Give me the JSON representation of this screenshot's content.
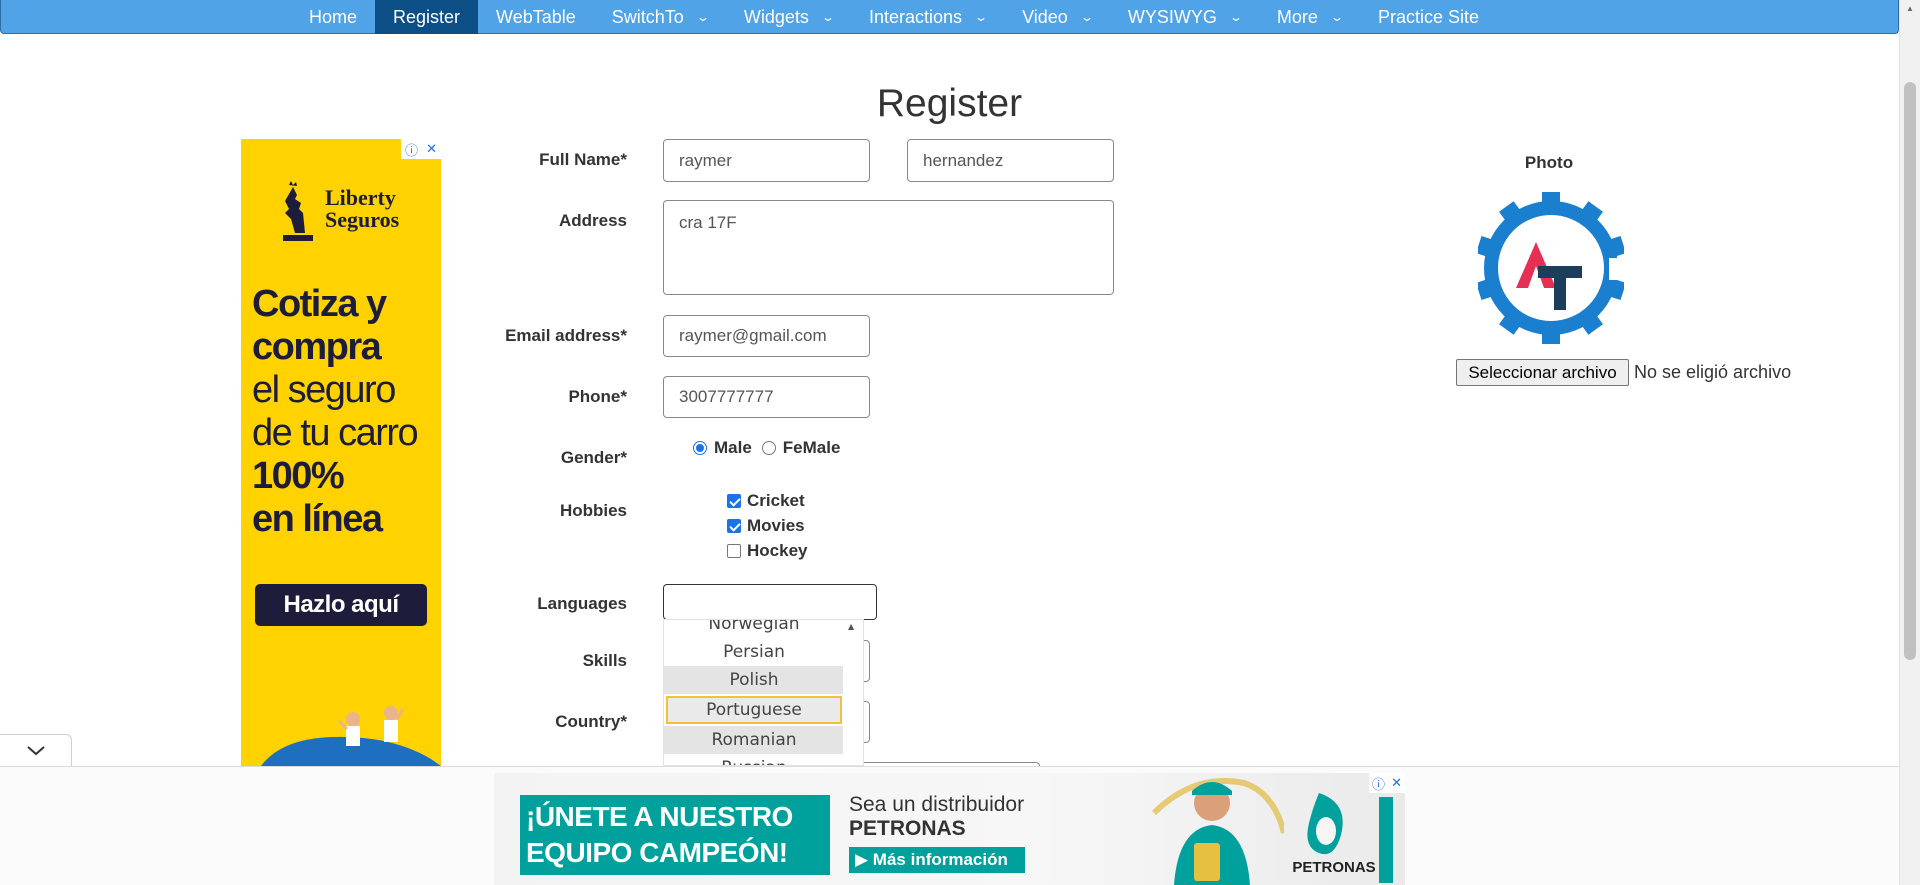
{
  "nav": {
    "items": [
      {
        "label": "Home",
        "dropdown": false,
        "active": false
      },
      {
        "label": "Register",
        "dropdown": false,
        "active": true
      },
      {
        "label": "WebTable",
        "dropdown": false,
        "active": false
      },
      {
        "label": "SwitchTo",
        "dropdown": true,
        "active": false
      },
      {
        "label": "Widgets",
        "dropdown": true,
        "active": false
      },
      {
        "label": "Interactions",
        "dropdown": true,
        "active": false
      },
      {
        "label": "Video",
        "dropdown": true,
        "active": false
      },
      {
        "label": "WYSIWYG",
        "dropdown": true,
        "active": false
      },
      {
        "label": "More",
        "dropdown": true,
        "active": false
      },
      {
        "label": "Practice Site",
        "dropdown": false,
        "active": false
      }
    ],
    "chevron_glyph": "⌄",
    "color": "#4fa3e6",
    "active_color": "#0b4f86"
  },
  "page": {
    "title": "Register"
  },
  "form": {
    "full_name_label": "Full Name*",
    "first_name_value": "raymer",
    "last_name_value": "hernandez",
    "address_label": "Address",
    "address_value": "cra 17F",
    "email_label": "Email address*",
    "email_value": "raymer@gmail.com",
    "phone_label": "Phone*",
    "phone_value": "3007777777",
    "gender_label": "Gender*",
    "gender_options": [
      "Male",
      "FeMale"
    ],
    "gender_selected": "Male",
    "hobbies_label": "Hobbies",
    "hobbies": [
      {
        "label": "Cricket",
        "checked": true
      },
      {
        "label": "Movies",
        "checked": true
      },
      {
        "label": "Hockey",
        "checked": false
      }
    ],
    "languages_label": "Languages",
    "languages_value": "",
    "language_options": [
      "Norwegian",
      "Persian",
      "Polish",
      "Portuguese",
      "Romanian",
      "Russian"
    ],
    "language_highlighted": "Portuguese",
    "skills_label": "Skills",
    "country_label": "Country*"
  },
  "photo": {
    "label": "Photo",
    "file_button": "Seleccionar archivo",
    "file_status": "No se eligió archivo",
    "logo_letters": "AT"
  },
  "left_ad": {
    "brand": "Liberty Seguros",
    "headline_1": "Cotiza y",
    "headline_2": "compra",
    "headline_3": "el seguro",
    "headline_4": "de tu carro",
    "headline_5": "100%",
    "headline_6": "en línea",
    "cta": "Hazlo aquí",
    "background": "#ffd200"
  },
  "bottom_ad": {
    "headline_1": "¡ÚNETE A NUESTRO",
    "headline_2": "EQUIPO CAMPEÓN!",
    "text_1": "Sea un distribuidor",
    "text_2": "PETRONAS",
    "cta": "▶ Más información",
    "brand": "PETRONAS",
    "accent": "#00a19c"
  },
  "icons": {
    "ad_info": "info-icon",
    "ad_close": "close-icon",
    "collapse": "chevron-down-icon"
  }
}
